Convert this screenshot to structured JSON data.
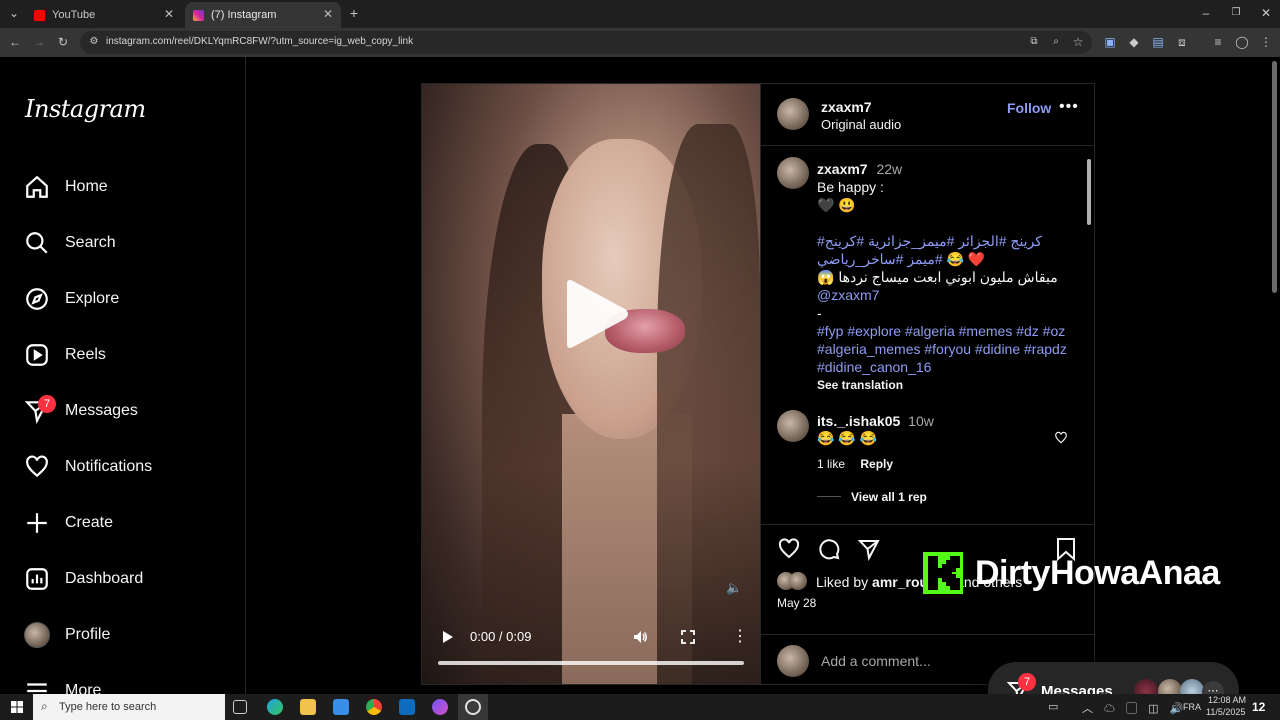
{
  "browser": {
    "tabs": [
      {
        "title": "YouTube",
        "active": false
      },
      {
        "title": "(7) Instagram",
        "active": true
      }
    ],
    "url": "instagram.com/reel/DKLYqmRC8FW/?utm_source=ig_web_copy_link"
  },
  "sidebar": {
    "logo": "Instagram",
    "items": [
      {
        "label": "Home",
        "icon": "home-icon"
      },
      {
        "label": "Search",
        "icon": "search-icon"
      },
      {
        "label": "Explore",
        "icon": "compass-icon"
      },
      {
        "label": "Reels",
        "icon": "reels-icon"
      },
      {
        "label": "Messages",
        "icon": "messenger-icon",
        "badge": "7"
      },
      {
        "label": "Notifications",
        "icon": "heart-icon"
      },
      {
        "label": "Create",
        "icon": "plus-icon"
      },
      {
        "label": "Dashboard",
        "icon": "dashboard-icon"
      },
      {
        "label": "Profile",
        "icon": "avatar"
      },
      {
        "label": "More",
        "icon": "menu-icon"
      }
    ]
  },
  "video": {
    "time": "0:00 / 0:09",
    "progress": 0
  },
  "post": {
    "author": "zxaxm7",
    "audio": "Original audio",
    "follow_label": "Follow",
    "caption": {
      "author": "zxaxm7",
      "age": "22w",
      "line1": "Be happy :",
      "line2": "🖤 😃",
      "tags_ar_1": "كرينج #الجزائر #ميمز_جزائرية #كرينج#",
      "tags_ar_2": "#ميمز #ساخر_رياضي",
      "tags_ar_2_emoji": "😂 ❤️",
      "ar_text": "مبقاش مليون ابوني ابعت ميساج نردها 😱",
      "mention": "@zxaxm7",
      "dash": "-",
      "tags_1": "#fyp #explore #algeria  #memes #dz #oz",
      "tags_2": "#algeria_memes #foryou #didine #rapdz",
      "tags_3": "#didine_canon_16",
      "see_translation": "See translation"
    },
    "comment": {
      "author": "its._.ishak05",
      "age": "10w",
      "text": "😂 😂 😂",
      "likes": "1 like",
      "reply": "Reply",
      "view_replies": "View all 1 rep"
    },
    "liked_by_prefix": "Liked by",
    "liked_by_user": "amr_rouichi",
    "liked_by_suffix": "and others",
    "date": "May 28",
    "add_comment_placeholder": "Add a comment..."
  },
  "watermark": "DirtyHowaAnaa",
  "floating_messages": {
    "label": "Messages",
    "badge": "7"
  },
  "taskbar": {
    "search_placeholder": "Type here to search",
    "lang": "FRA",
    "time": "12:08 AM",
    "date": "11/5/2025",
    "notif": "12"
  },
  "colors": {
    "link": "#8e9cf3",
    "badge": "#ff3040",
    "kick_green": "#53fc18"
  }
}
